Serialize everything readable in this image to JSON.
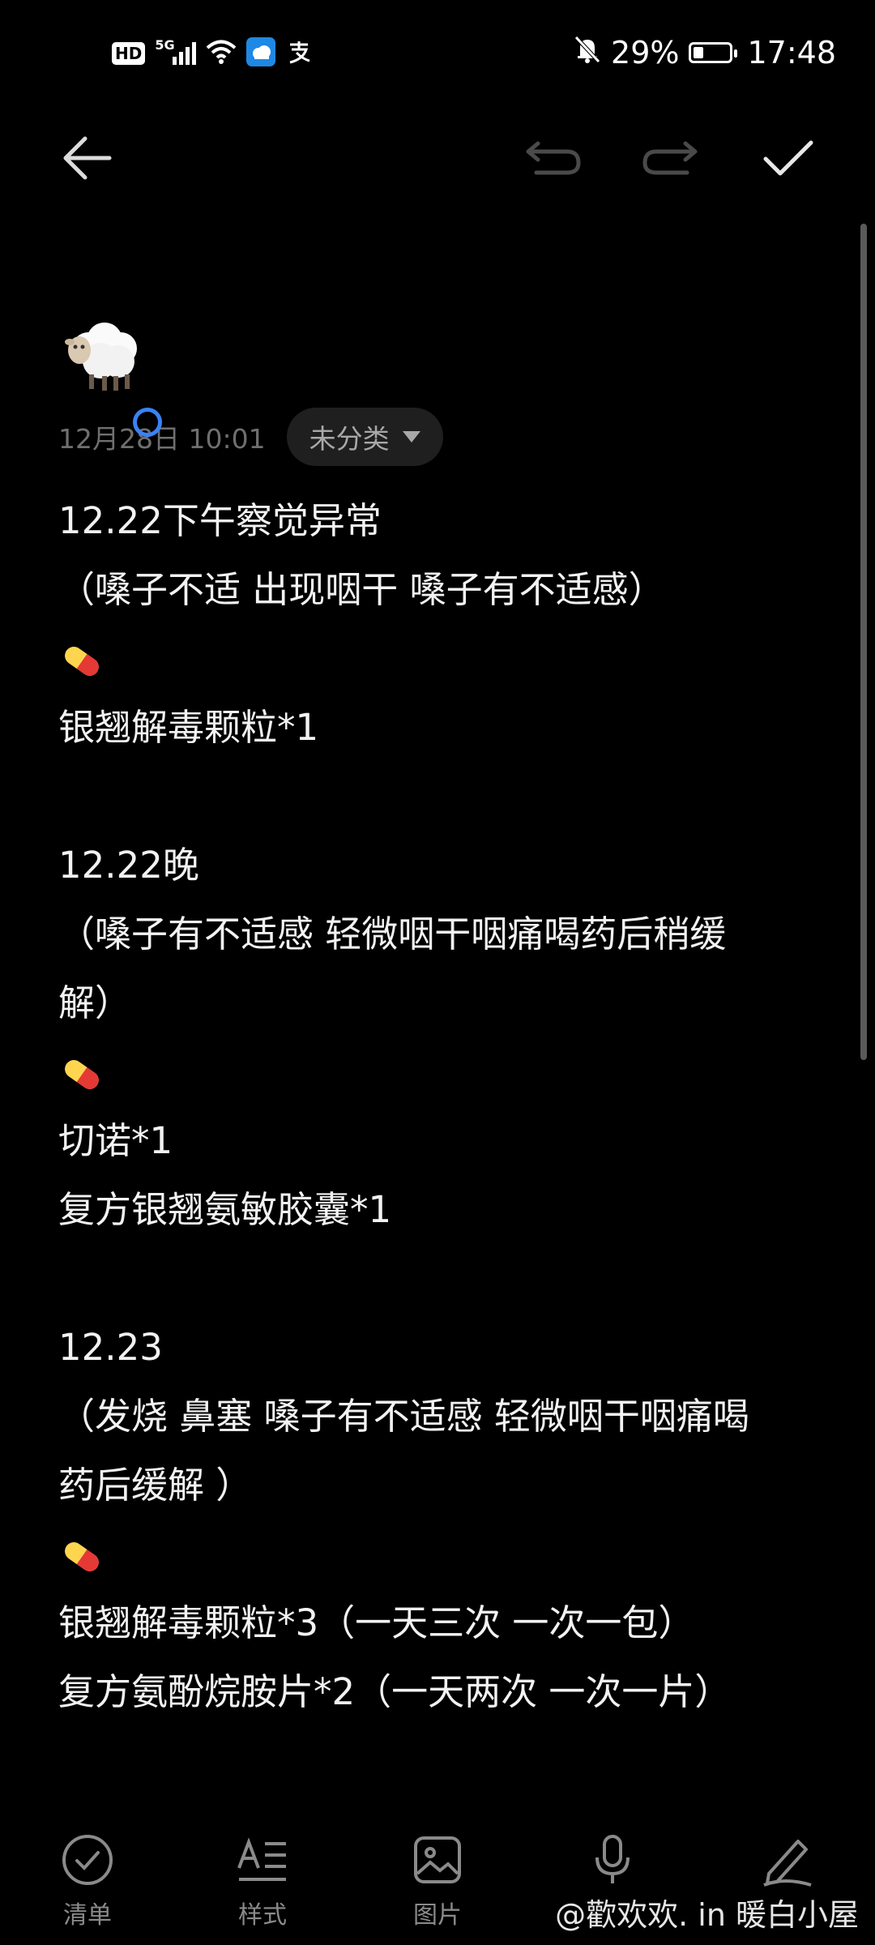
{
  "status_bar": {
    "hd": "HD",
    "network": "5G",
    "battery_percent": "29%",
    "battery_level": 0.29,
    "time": "17:48",
    "icons": [
      "hd-icon",
      "signal-5g-icon",
      "wifi-icon",
      "weather-icon",
      "alipay-icon",
      "mute-bell-icon",
      "battery-icon"
    ]
  },
  "toolbar": {
    "icons": [
      "back-arrow-icon",
      "undo-icon",
      "redo-icon",
      "check-icon"
    ]
  },
  "note": {
    "date": "12月28日 10:01",
    "category": "未分类",
    "lines": [
      "12.22下午察觉异常",
      "（嗓子不适 出现咽干 嗓子有不适感）",
      "💊",
      "银翘解毒颗粒*1",
      "",
      "12.22晚",
      "（嗓子有不适感 轻微咽干咽痛喝药后稍缓",
      "解）",
      "💊",
      "切诺*1",
      "复方银翘氨敏胶囊*1",
      "",
      "12.23",
      "（发烧 鼻塞 嗓子有不适感 轻微咽干咽痛喝",
      "药后缓解 ）",
      "💊",
      "银翘解毒颗粒*3（一天三次 一次一包）",
      "复方氨酚烷胺片*2（一天两次 一次一片）"
    ]
  },
  "bottom_bar": {
    "items": [
      {
        "label": "清单",
        "icon": "checklist-icon"
      },
      {
        "label": "样式",
        "icon": "text-style-icon"
      },
      {
        "label": "图片",
        "icon": "image-icon"
      },
      {
        "label": "语音",
        "icon": "microphone-icon"
      },
      {
        "label": "手写",
        "icon": "handwriting-icon"
      }
    ]
  },
  "watermark": "@歡欢欢. in 暖白小屋",
  "colors": {
    "background": "#000000",
    "text": "#f2f2f2",
    "muted": "#6f6f6f",
    "accent_cursor": "#3b82f6"
  }
}
